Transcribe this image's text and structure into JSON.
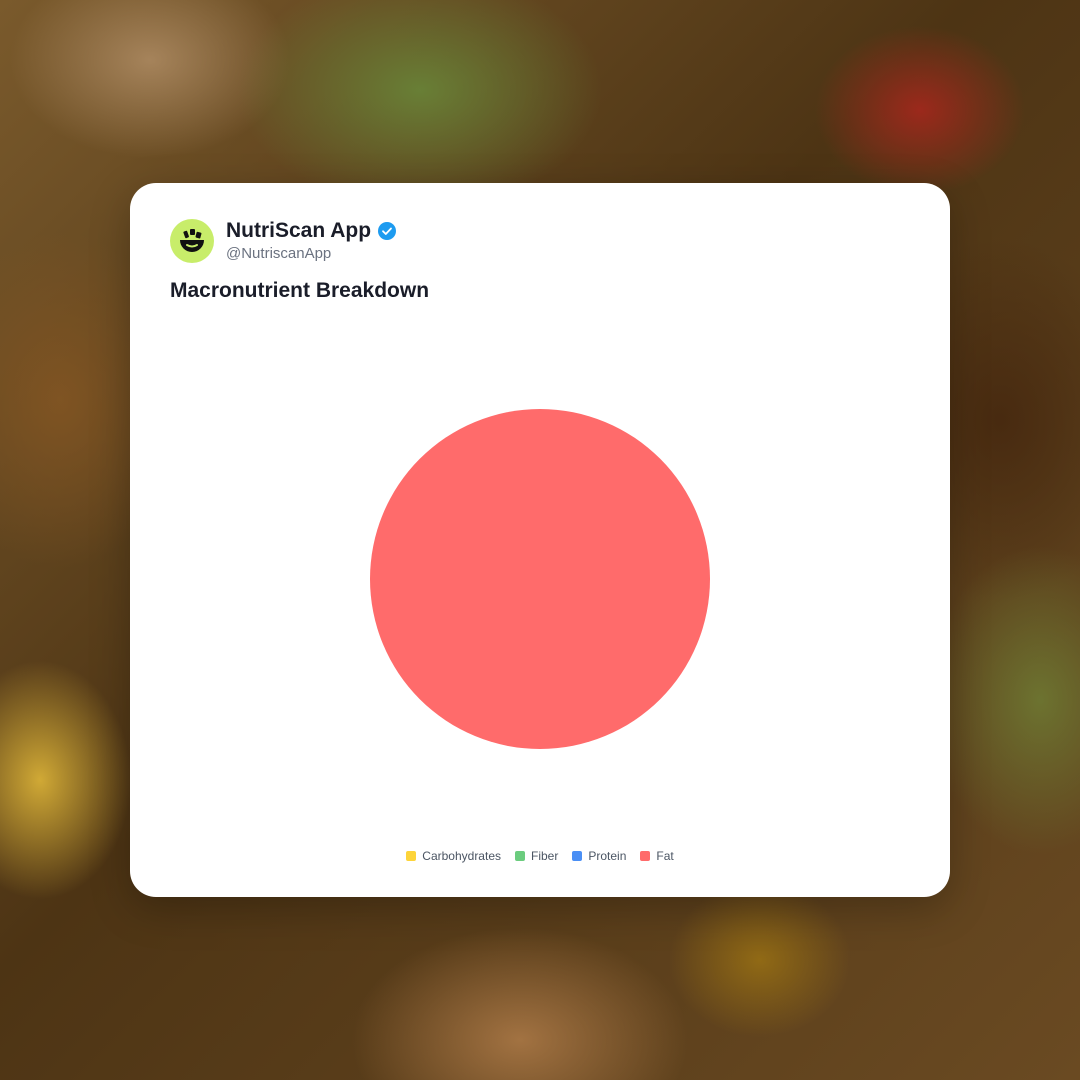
{
  "post": {
    "display_name": "NutriScan App",
    "handle": "@NutriscanApp",
    "avatar_icon": "smiling-bowl-logo",
    "verified_icon": "verified-check-icon",
    "colors": {
      "avatar_bg": "#c8ed6a",
      "verified": "#1d9bf0"
    }
  },
  "chart_data": {
    "type": "pie",
    "title": "Macronutrient Breakdown",
    "categories": [
      "Carbohydrates",
      "Fiber",
      "Protein",
      "Fat"
    ],
    "values": [
      0,
      0,
      0,
      100
    ],
    "colors": [
      "#fdd43a",
      "#6bcc7e",
      "#4a8ff5",
      "#ff6b6b"
    ],
    "legend_position": "bottom"
  }
}
